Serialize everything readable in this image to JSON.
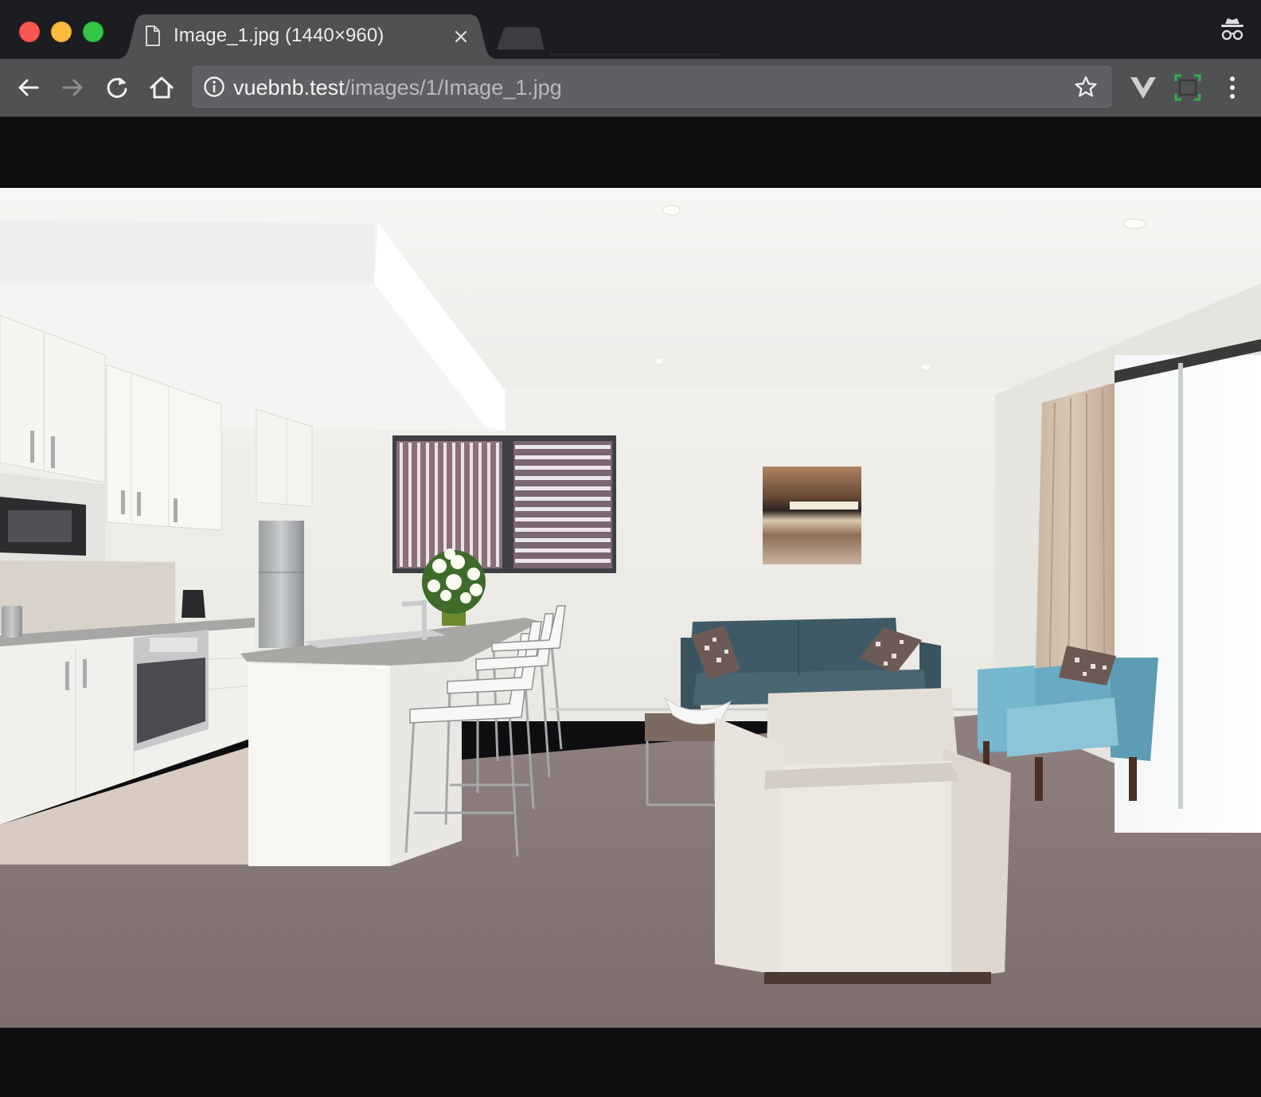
{
  "window": {
    "controls": [
      "close",
      "minimize",
      "maximize"
    ]
  },
  "tab": {
    "title": "Image_1.jpg (1440×960)",
    "icon": "file-icon",
    "close_icon": "close-icon"
  },
  "toolbar": {
    "back_icon": "arrow-left-icon",
    "forward_icon": "arrow-right-icon",
    "reload_icon": "reload-icon",
    "home_icon": "home-icon"
  },
  "address_bar": {
    "info_icon": "info-icon",
    "host": "vuebnb.test",
    "path": "/images/1/Image_1.jpg",
    "bookmark_icon": "star-icon"
  },
  "extensions": [
    "vue-devtools-icon",
    "screenshot-extension-icon",
    "more-menu-icon"
  ],
  "profile": {
    "icon": "incognito-icon"
  },
  "image": {
    "description_icon": "apartment-interior-photo"
  },
  "colors": {
    "tabstrip": "#1c1d20",
    "active_tab": "#505153",
    "toolbar": "#505153",
    "omnibox": "#5f6063",
    "page_background": "#0e0e10"
  }
}
